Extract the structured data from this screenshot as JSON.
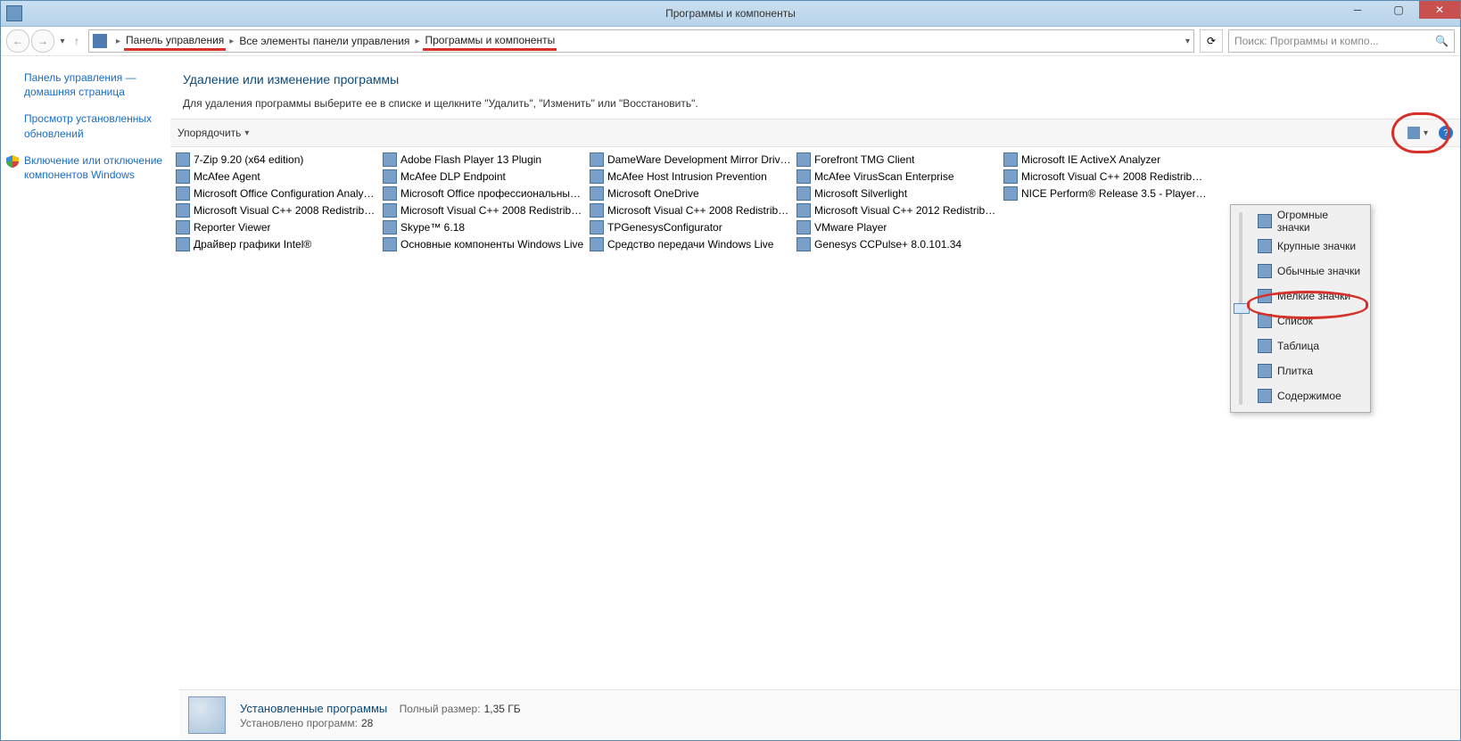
{
  "window": {
    "title": "Программы и компоненты"
  },
  "breadcrumb": {
    "items": [
      "Панель управления",
      "Все элементы панели управления",
      "Программы и компоненты"
    ]
  },
  "search": {
    "placeholder": "Поиск: Программы и компо..."
  },
  "leftnav": {
    "home": "Панель управления — домашняя страница",
    "updates": "Просмотр установленных обновлений",
    "features": "Включение или отключение компонентов Windows"
  },
  "header": {
    "title": "Удаление или изменение программы",
    "subtitle": "Для удаления программы выберите ее в списке и щелкните \"Удалить\", \"Изменить\" или \"Восстановить\"."
  },
  "toolbar": {
    "organize": "Упорядочить"
  },
  "programs": [
    "7-Zip 9.20 (x64 edition)",
    "McAfee Agent",
    "Microsoft Office Configuration Analyzer...",
    "Microsoft Visual C++ 2008 Redistributa...",
    "Reporter Viewer",
    "Драйвер графики Intel®",
    "Adobe Flash Player 13 Plugin",
    "McAfee DLP Endpoint",
    "Microsoft Office профессиональный п...",
    "Microsoft Visual C++ 2008 Redistributa...",
    "Skype™ 6.18",
    "Основные компоненты Windows Live",
    "DameWare Development Mirror Driver ...",
    "McAfee Host Intrusion Prevention",
    "Microsoft OneDrive",
    "Microsoft Visual C++ 2008 Redistributa...",
    "TPGenesysConfigurator",
    "Средство передачи Windows Live",
    "Forefront TMG Client",
    "McAfee VirusScan Enterprise",
    "Microsoft Silverlight",
    "Microsoft Visual C++ 2012 Redistributa...",
    "VMware Player",
    "Genesys CCPulse+ 8.0.101.34",
    "Microsoft IE ActiveX Analyzer",
    "Microsoft Visual C++ 2008 Redistributa...",
    "NICE Perform® Release 3.5 - Player Co..."
  ],
  "viewMenu": {
    "options": [
      "Огромные значки",
      "Крупные значки",
      "Обычные значки",
      "Мелкие значки",
      "Список",
      "Таблица",
      "Плитка",
      "Содержимое"
    ],
    "selectedIndex": 3
  },
  "status": {
    "title": "Установленные программы",
    "sizeKey": "Полный размер:",
    "sizeVal": "1,35 ГБ",
    "countKey": "Установлено программ:",
    "countVal": "28"
  }
}
